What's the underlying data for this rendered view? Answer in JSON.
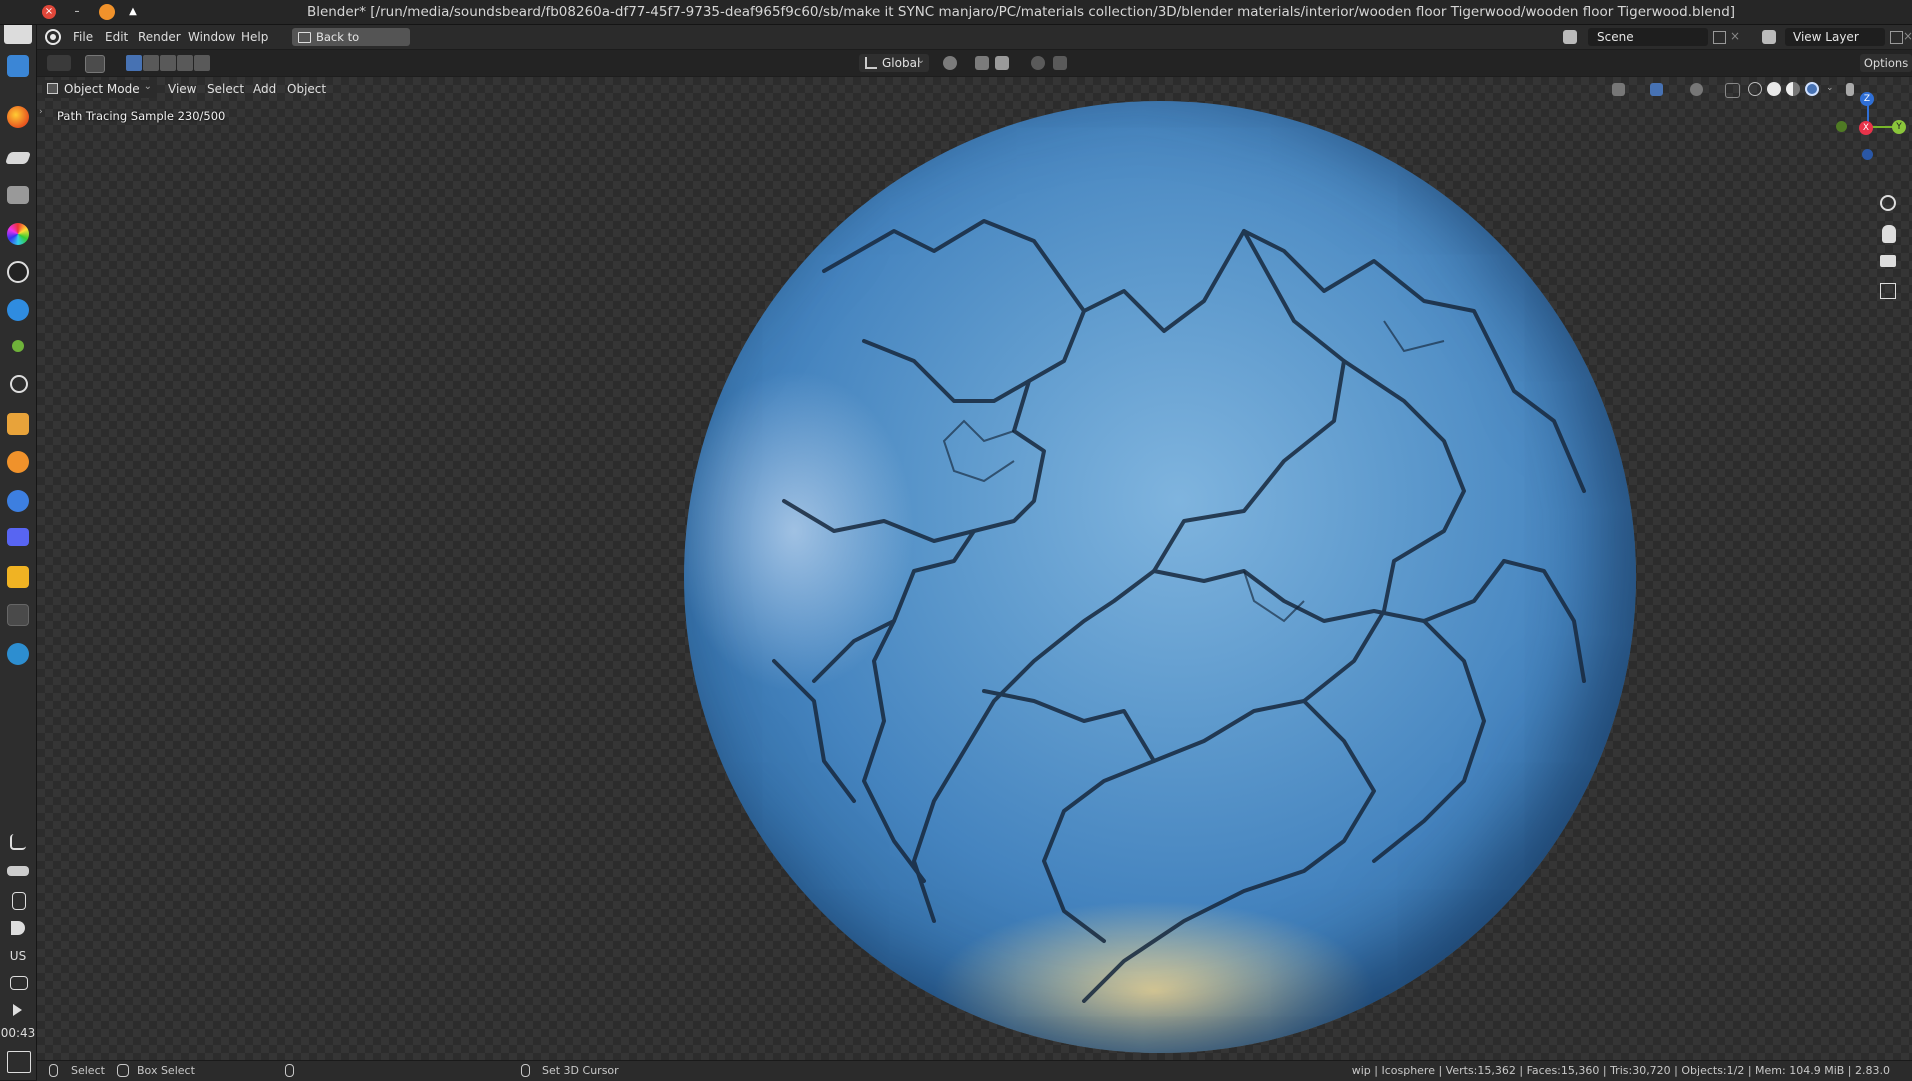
{
  "window": {
    "title": "Blender* [/run/media/soundsbeard/fb08260a-df77-45f7-9735-deaf965f9c60/sb/make it SYNC manjaro/PC/materials collection/3D/blender materials/interior/wooden floor Tigerwood/wooden floor Tigerwood.blend]"
  },
  "dock": {
    "language": "US",
    "clock": "00:43"
  },
  "topbar": {
    "menus": [
      "File",
      "Edit",
      "Render",
      "Window",
      "Help"
    ],
    "back_button": "Back to Previous",
    "scene": "Scene",
    "view_layer": "View Layer"
  },
  "tool_header": {
    "orientation": "Global",
    "options": "Options"
  },
  "viewport": {
    "mode": "Object Mode",
    "menus": [
      "View",
      "Select",
      "Add",
      "Object"
    ],
    "overlay_text": "Path Tracing Sample 230/500",
    "gizmo": {
      "z": "Z",
      "y": "Y",
      "x": "X"
    }
  },
  "statusbar": {
    "select": "Select",
    "box_select": "Box Select",
    "cursor": "Set 3D Cursor",
    "stats": "wip | Icosphere | Verts:15,362 | Faces:15,360 | Tris:30,720 | Objects:1/2 | Mem: 104.9 MiB | 2.83.0"
  },
  "colors": {
    "accent": "#4772b3",
    "close": "#e0473a",
    "sphere_blue": "#4584bf"
  },
  "icons": {
    "dock": [
      "avatar",
      "files-icon",
      "firefox-icon",
      "layers-icon",
      "panel-icon",
      "color-wheel-icon",
      "obs-icon",
      "thunderbird-icon",
      "green-dot-icon",
      "search-icon",
      "archive-icon",
      "blender-orange-icon",
      "vpn-icon",
      "discord-icon",
      "discord-yellow-icon",
      "blender-icon",
      "steam-icon",
      "feather-icon",
      "stack-icon",
      "clipboard-icon",
      "volume-icon",
      "monitor-icon",
      "play-icon",
      "desktop-icon"
    ]
  }
}
